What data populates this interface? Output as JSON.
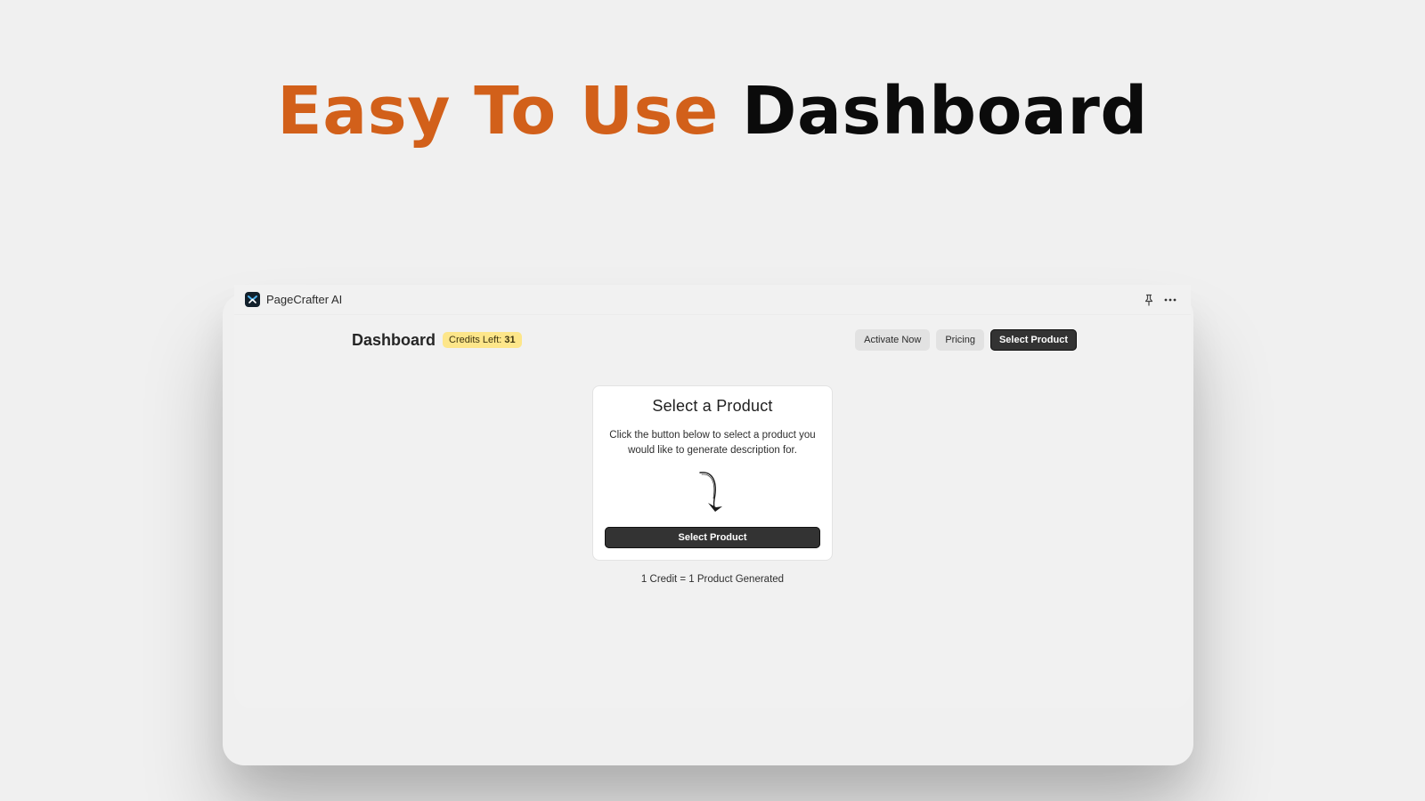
{
  "hero": {
    "accent": "Easy To Use",
    "main": "Dashboard"
  },
  "app": {
    "name": "PageCrafter AI",
    "icons": [
      "app-logo",
      "pin-icon",
      "more-icon"
    ]
  },
  "header": {
    "title": "Dashboard",
    "credits_label": "Credits Left:",
    "credits_value": "31",
    "buttons": {
      "activate": "Activate Now",
      "pricing": "Pricing",
      "select": "Select Product"
    }
  },
  "card": {
    "title": "Select a Product",
    "description": "Click the button below to select a product you would like to generate description for.",
    "button": "Select Product",
    "footnote": "1 Credit = 1 Product Generated"
  },
  "colors": {
    "accent": "#d2601a",
    "background": "#f0f0f0",
    "badge": "#fde68a",
    "dark_button": "#333333"
  }
}
